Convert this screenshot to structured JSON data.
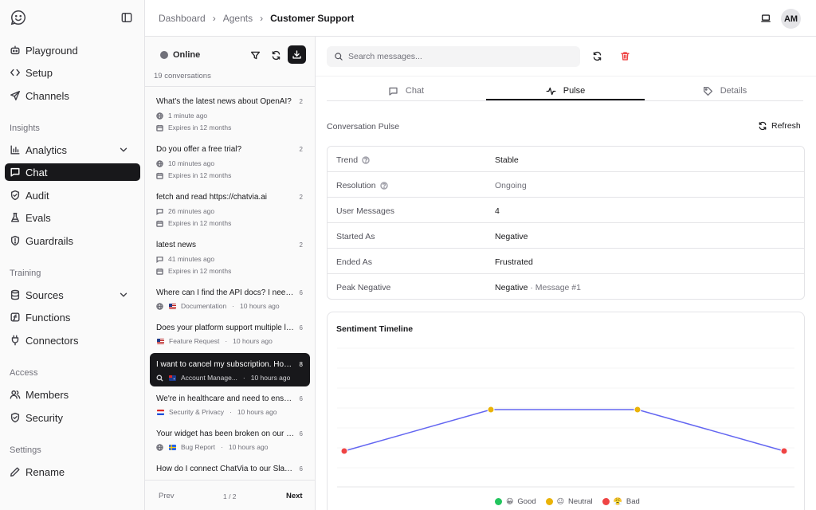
{
  "colors": {
    "accent": "#18181b",
    "line": "#6366f1",
    "good": "#22c55e",
    "neutral": "#eab308",
    "bad": "#ef4444",
    "delete": "#ef4444"
  },
  "sidebar": {
    "logo_icon": "smiley-chat-icon",
    "items": [
      {
        "label": "Playground",
        "icon": "robot-icon"
      },
      {
        "label": "Setup",
        "icon": "code-icon"
      },
      {
        "label": "Channels",
        "icon": "send-icon"
      }
    ],
    "sections": [
      {
        "title": "Insights",
        "items": [
          {
            "label": "Analytics",
            "icon": "bar-chart-icon",
            "expandable": true
          },
          {
            "label": "Chat",
            "icon": "message-icon",
            "active": true
          },
          {
            "label": "Audit",
            "icon": "shield-check-icon"
          },
          {
            "label": "Evals",
            "icon": "flask-icon"
          },
          {
            "label": "Guardrails",
            "icon": "shield-alert-icon"
          }
        ]
      },
      {
        "title": "Training",
        "items": [
          {
            "label": "Sources",
            "icon": "database-icon",
            "expandable": true
          },
          {
            "label": "Functions",
            "icon": "function-icon"
          },
          {
            "label": "Connectors",
            "icon": "plug-icon"
          }
        ]
      },
      {
        "title": "Access",
        "items": [
          {
            "label": "Members",
            "icon": "users-icon"
          },
          {
            "label": "Security",
            "icon": "shield-icon"
          }
        ]
      },
      {
        "title": "Settings",
        "items": [
          {
            "label": "Rename",
            "icon": "pencil-icon"
          }
        ]
      }
    ]
  },
  "header": {
    "breadcrumb": [
      "Dashboard",
      "Agents",
      "Customer Support"
    ],
    "avatar_initials": "AM"
  },
  "conversations": {
    "status": "Online",
    "count_label": "19 conversations",
    "items": [
      {
        "title": "What's the latest news about OpenAI?",
        "count": "2",
        "meta1_icon": "globe-icon",
        "meta1": "1 minute ago",
        "meta2": "Expires in 12 months"
      },
      {
        "title": "Do you offer a free trial?",
        "count": "2",
        "meta1_icon": "globe-icon",
        "meta1": "10 minutes ago",
        "meta2": "Expires in 12 months"
      },
      {
        "title": "fetch and read https://chatvia.ai",
        "count": "2",
        "meta1_icon": "message-icon",
        "meta1": "26 minutes ago",
        "meta2": "Expires in 12 months"
      },
      {
        "title": "latest news",
        "count": "2",
        "meta1_icon": "message-icon",
        "meta1": "41 minutes ago",
        "meta2": "Expires in 12 months"
      },
      {
        "title": "Where can I find the API docs? I need to integrate your service",
        "count": "6",
        "meta1_icon": "globe-icon",
        "flag": "us",
        "tag": "Documentation",
        "time": "10 hours ago"
      },
      {
        "title": "Does your platform support multiple languages for our team",
        "count": "6",
        "flag": "us",
        "tag": "Feature Request",
        "time": "10 hours ago"
      },
      {
        "title": "I want to cancel my subscription. How do I do that?",
        "count": "8",
        "meta1_icon": "search-icon",
        "flag": "au",
        "tag": "Account Management",
        "tag_display": "Account Manage...",
        "time": "10 hours ago",
        "selected": true
      },
      {
        "title": "We're in healthcare and need to ensure compliance",
        "count": "6",
        "flag": "nl",
        "tag": "Security & Privacy",
        "time": "10 hours ago"
      },
      {
        "title": "Your widget has been broken on our site since yesterday",
        "count": "6",
        "meta1_icon": "globe-icon",
        "flag": "se",
        "tag": "Bug Report",
        "time": "10 hours ago"
      },
      {
        "title": "How do I connect ChatVia to our Slack workspace?",
        "count": "6"
      }
    ],
    "pager": {
      "prev": "Prev",
      "page": "1 / 2",
      "next": "Next"
    }
  },
  "main": {
    "search_placeholder": "Search messages...",
    "tabs": [
      {
        "label": "Chat",
        "icon": "message-icon"
      },
      {
        "label": "Pulse",
        "icon": "activity-icon",
        "active": true
      },
      {
        "label": "Details",
        "icon": "tag-icon"
      }
    ],
    "pulse": {
      "title": "Conversation Pulse",
      "refresh_label": "Refresh",
      "rows": [
        {
          "key": "Trend",
          "help": true,
          "value": "Stable"
        },
        {
          "key": "Resolution",
          "help": true,
          "value": "Ongoing",
          "muted": true
        },
        {
          "key": "User Messages",
          "value": "4"
        },
        {
          "key": "Started As",
          "value": "Negative"
        },
        {
          "key": "Ended As",
          "value": "Frustrated"
        },
        {
          "key": "Peak Negative",
          "value": "Negative",
          "sub": " · Message #1"
        }
      ]
    },
    "timeline": {
      "title": "Sentiment Timeline",
      "legend": [
        {
          "label": "Good",
          "emoji": "😀",
          "color": "#22c55e"
        },
        {
          "label": "Neutral",
          "emoji": "😐",
          "color": "#eab308"
        },
        {
          "label": "Bad",
          "emoji": "😤",
          "color": "#ef4444"
        }
      ]
    }
  },
  "chart_data": {
    "type": "line",
    "title": "Sentiment Timeline",
    "x": [
      1,
      2,
      3,
      4
    ],
    "series": [
      {
        "values": [
          "Bad",
          "Neutral",
          "Neutral",
          "Bad"
        ]
      }
    ],
    "levels": [
      "Bad",
      "Neutral",
      "Good"
    ],
    "grid": true,
    "legend_position": "bottom"
  }
}
